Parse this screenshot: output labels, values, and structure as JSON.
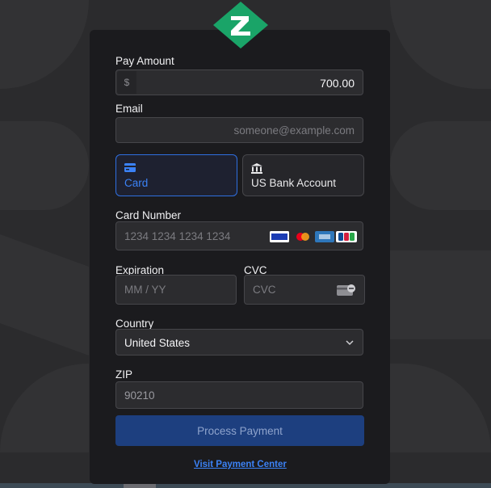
{
  "form": {
    "pay_amount_label": "Pay Amount",
    "currency_symbol": "$",
    "pay_amount_value": "700.00",
    "email_label": "Email",
    "email_placeholder": "someone@example.com",
    "card_number_label": "Card Number",
    "card_number_placeholder": "1234 1234 1234 1234",
    "expiration_label": "Expiration",
    "expiration_placeholder": "MM / YY",
    "cvc_label": "CVC",
    "cvc_placeholder": "CVC",
    "country_label": "Country",
    "country_value": "United States",
    "zip_label": "ZIP",
    "zip_value": "90210",
    "submit_label": "Process Payment",
    "link_label": "Visit Payment Center"
  },
  "payment_methods": [
    {
      "label": "Card",
      "icon": "card-icon",
      "active": true
    },
    {
      "label": "US Bank Account",
      "icon": "bank-icon",
      "active": false
    }
  ],
  "card_brands": [
    "visa",
    "mastercard",
    "amex",
    "jcb"
  ],
  "colors": {
    "accent": "#2f6fe0",
    "button": "#1d3f7f",
    "logo": "#1aa468",
    "panel": "#1b1b1e"
  }
}
